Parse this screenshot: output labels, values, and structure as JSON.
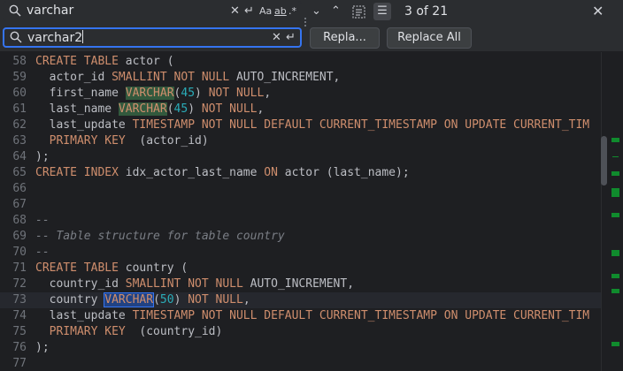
{
  "find": {
    "query": "varchar",
    "match_count": "3 of 21"
  },
  "replace": {
    "value": "varchar2",
    "replace_label": "Repla...",
    "replace_all_label": "Replace All"
  },
  "options": {
    "match_case": "Aa",
    "words": "ab",
    "regex": ".*"
  },
  "colors": {
    "accent": "#3574f0",
    "match_bg": "#32593d",
    "current_match_bg": "#214283",
    "keyword": "#cf8e6d",
    "number": "#2aacb8",
    "comment": "#7a7e85"
  },
  "lines": [
    {
      "n": "58",
      "segs": [
        {
          "t": "CREATE TABLE",
          "c": "kw"
        },
        {
          "t": " actor ("
        }
      ]
    },
    {
      "n": "59",
      "segs": [
        {
          "t": "  actor_id "
        },
        {
          "t": "SMALLINT NOT NULL",
          "c": "kw"
        },
        {
          "t": " AUTO_INCREMENT,"
        }
      ]
    },
    {
      "n": "60",
      "segs": [
        {
          "t": "  first_name "
        },
        {
          "t": "VARCHAR",
          "c": "kw hl"
        },
        {
          "t": "("
        },
        {
          "t": "45",
          "c": "num"
        },
        {
          "t": ") "
        },
        {
          "t": "NOT NULL",
          "c": "kw"
        },
        {
          "t": ","
        }
      ]
    },
    {
      "n": "61",
      "segs": [
        {
          "t": "  last_name "
        },
        {
          "t": "VARCHAR",
          "c": "kw hl"
        },
        {
          "t": "("
        },
        {
          "t": "45",
          "c": "num"
        },
        {
          "t": ") "
        },
        {
          "t": "NOT NULL",
          "c": "kw"
        },
        {
          "t": ","
        }
      ]
    },
    {
      "n": "62",
      "segs": [
        {
          "t": "  last_update "
        },
        {
          "t": "TIMESTAMP NOT NULL DEFAULT CURRENT_TIMESTAMP ON UPDATE CURRENT_TIM",
          "c": "kw"
        }
      ]
    },
    {
      "n": "63",
      "segs": [
        {
          "t": "  "
        },
        {
          "t": "PRIMARY KEY",
          "c": "kw"
        },
        {
          "t": "  (actor_id)"
        }
      ]
    },
    {
      "n": "64",
      "segs": [
        {
          "t": ");"
        }
      ]
    },
    {
      "n": "65",
      "segs": [
        {
          "t": "CREATE INDEX",
          "c": "kw"
        },
        {
          "t": " idx_actor_last_name "
        },
        {
          "t": "ON",
          "c": "kw"
        },
        {
          "t": " actor (last_name);"
        }
      ]
    },
    {
      "n": "66",
      "segs": []
    },
    {
      "n": "67",
      "segs": []
    },
    {
      "n": "68",
      "segs": [
        {
          "t": "--",
          "c": "cmt"
        }
      ]
    },
    {
      "n": "69",
      "segs": [
        {
          "t": "-- Table structure for table country",
          "c": "cmt"
        }
      ]
    },
    {
      "n": "70",
      "segs": [
        {
          "t": "--",
          "c": "cmt"
        }
      ]
    },
    {
      "n": "71",
      "segs": [
        {
          "t": "CREATE TABLE",
          "c": "kw"
        },
        {
          "t": " country ("
        }
      ]
    },
    {
      "n": "72",
      "segs": [
        {
          "t": "  country_id "
        },
        {
          "t": "SMALLINT NOT NULL",
          "c": "kw"
        },
        {
          "t": " AUTO_INCREMENT,"
        }
      ]
    },
    {
      "n": "73",
      "current": true,
      "segs": [
        {
          "t": "  country "
        },
        {
          "t": "VARCHAR",
          "c": "kw hlcur"
        },
        {
          "t": "("
        },
        {
          "t": "50",
          "c": "num"
        },
        {
          "t": ") "
        },
        {
          "t": "NOT NULL",
          "c": "kw"
        },
        {
          "t": ","
        }
      ]
    },
    {
      "n": "74",
      "segs": [
        {
          "t": "  last_update "
        },
        {
          "t": "TIMESTAMP NOT NULL DEFAULT CURRENT_TIMESTAMP ON UPDATE CURRENT_TIM",
          "c": "kw"
        }
      ]
    },
    {
      "n": "75",
      "segs": [
        {
          "t": "  "
        },
        {
          "t": "PRIMARY KEY",
          "c": "kw"
        },
        {
          "t": "  (country_id)"
        }
      ]
    },
    {
      "n": "76",
      "segs": [
        {
          "t": ");"
        }
      ]
    },
    {
      "n": "77",
      "segs": []
    }
  ]
}
